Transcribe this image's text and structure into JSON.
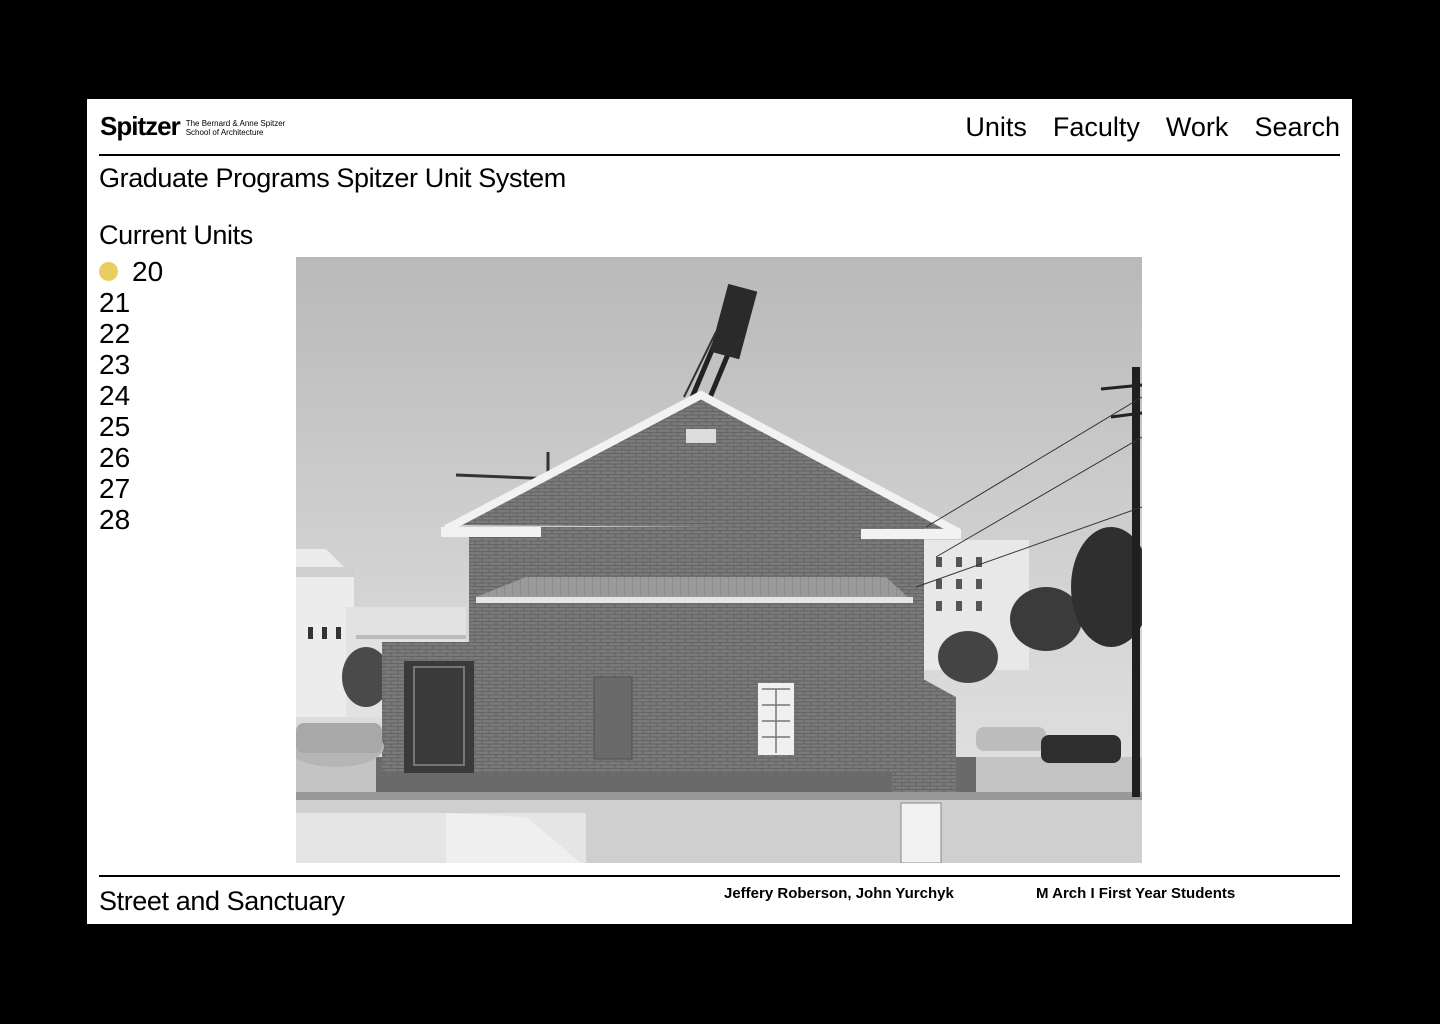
{
  "colors": {
    "frame": "#000000",
    "page": "#ffffff",
    "text": "#000000",
    "active_dot": "#e7cf5f"
  },
  "header": {
    "logo": {
      "wordmark": "Spitzer",
      "subtitle_line1": "The Bernard & Anne Spitzer",
      "subtitle_line2": "School of Architecture"
    },
    "nav": [
      {
        "label": "Units"
      },
      {
        "label": "Faculty"
      },
      {
        "label": "Work"
      },
      {
        "label": "Search"
      }
    ]
  },
  "program_title": "Graduate Programs Spitzer Unit System",
  "units": {
    "heading": "Current Units",
    "active_indicator": "yellow-dot-icon",
    "items": [
      {
        "label": "20",
        "active": true
      },
      {
        "label": "21",
        "active": false
      },
      {
        "label": "22",
        "active": false
      },
      {
        "label": "23",
        "active": false
      },
      {
        "label": "24",
        "active": false
      },
      {
        "label": "25",
        "active": false
      },
      {
        "label": "26",
        "active": false
      },
      {
        "label": "27",
        "active": false
      },
      {
        "label": "28",
        "active": false
      }
    ]
  },
  "feature_image": {
    "subject": "black-and-white photograph of a gabled brick building with cranes behind it"
  },
  "project": {
    "title": "Street and Sanctuary",
    "faculty": "Jeffery Roberson, John Yurchyk",
    "level": "M Arch I First Year Students"
  }
}
